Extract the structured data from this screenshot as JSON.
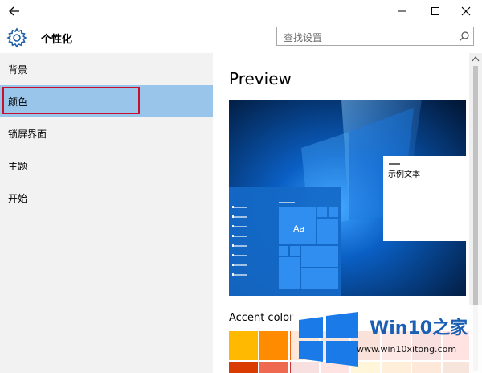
{
  "header": {
    "title": "个性化",
    "search_placeholder": "查找设置"
  },
  "sidebar": {
    "items": [
      {
        "label": "背景"
      },
      {
        "label": "颜色",
        "selected": true
      },
      {
        "label": "锁屏界面"
      },
      {
        "label": "主题"
      },
      {
        "label": "开始"
      }
    ]
  },
  "main": {
    "preview_title": "Preview",
    "preview_tile_label": "Aa",
    "preview_sample_text": "示例文本",
    "accent_title": "Accent color"
  },
  "accent_swatches": [
    "#ffb900",
    "#ff8c00",
    "#f7630c",
    "#ca5010",
    "#da3b01",
    "#ef6950",
    "#d13438",
    "#ff4343"
  ],
  "watermark": {
    "brand": "Win10",
    "brand_suffix": "之家",
    "url": "www.win10xitong.com"
  },
  "colors": {
    "accent": "#0078d7",
    "selected_bg": "#99c5ea",
    "highlight_border": "#c8102e"
  }
}
